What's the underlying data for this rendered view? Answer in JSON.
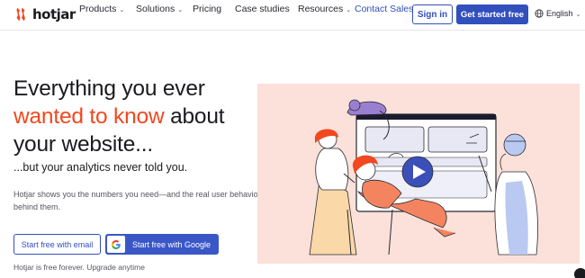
{
  "brand": {
    "name": "hotjar"
  },
  "nav": {
    "items": [
      {
        "label": "Products",
        "has_dropdown": true
      },
      {
        "label": "Solutions",
        "has_dropdown": true
      },
      {
        "label": "Pricing",
        "has_dropdown": false
      },
      {
        "label": "Case studies",
        "has_dropdown": false
      },
      {
        "label": "Resources",
        "has_dropdown": true
      }
    ],
    "contact_sales": "Contact Sales",
    "sign_in": "Sign in",
    "get_started": "Get started free",
    "language": "English",
    "chevron_glyph": "⌄"
  },
  "hero": {
    "headline_part1": "Everything you ever",
    "headline_accent": "wanted to know",
    "headline_part2": "about your website...",
    "subhead": "...but your analytics never told you.",
    "description": "Hotjar shows you the numbers you need—and the real user behavior behind them.",
    "cta_email": "Start free with email",
    "cta_google": "Start free with Google",
    "free_note": "Hotjar is free forever. Upgrade anytime"
  },
  "colors": {
    "primary": "#324fbe",
    "accent": "#f1481f",
    "illustration_bg": "#fbe1d9",
    "play_button": "#3a4fb8"
  },
  "icons": {
    "logo": "hotjar-logo-icon",
    "globe": "globe-icon",
    "google": "google-g-icon",
    "play": "play-icon"
  }
}
